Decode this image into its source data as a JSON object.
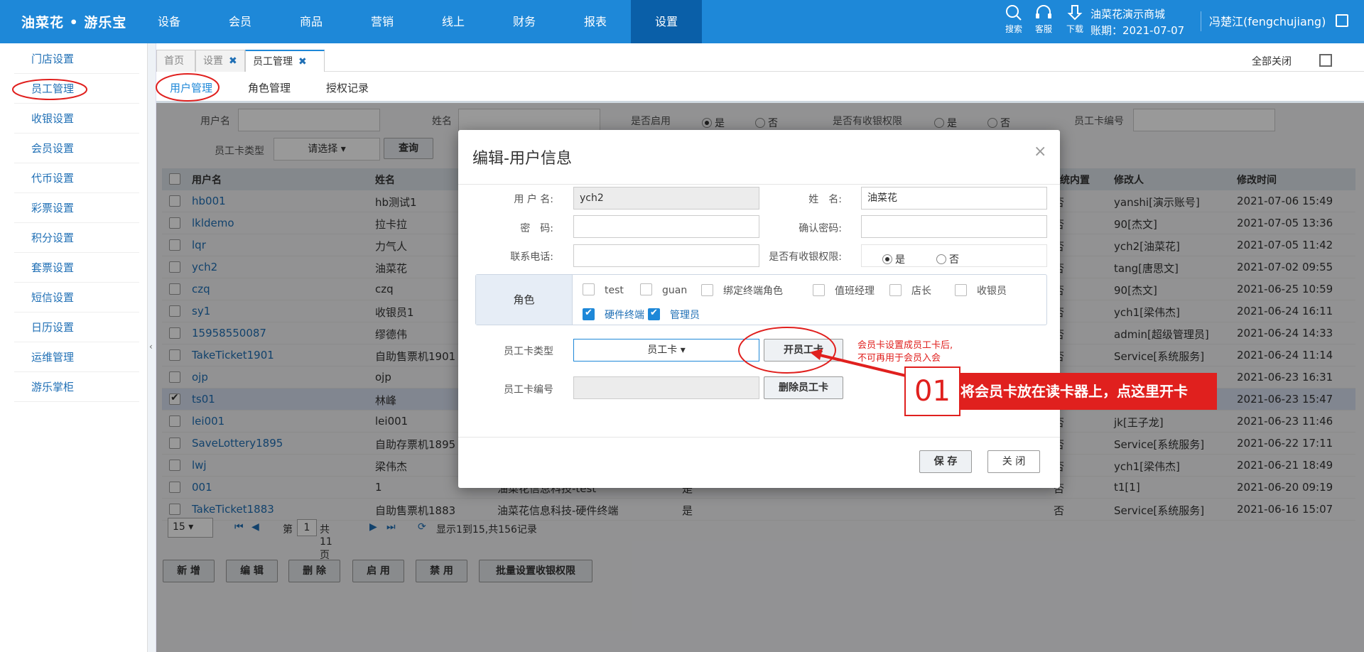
{
  "app": {
    "logo": "油菜花 • 游乐宝"
  },
  "nav": [
    "设备",
    "会员",
    "商品",
    "营销",
    "线上",
    "财务",
    "报表",
    "设置"
  ],
  "topright": {
    "icons": [
      {
        "label": "搜索",
        "icon": "search-icon"
      },
      {
        "label": "客服",
        "icon": "headset-icon"
      },
      {
        "label": "下载",
        "icon": "download-icon"
      }
    ],
    "store": "油菜花演示商城",
    "account_period": "账期：2021-07-07",
    "user": "冯楚江(fengchujiang)"
  },
  "sidebar": [
    "门店设置",
    "员工管理",
    "收银设置",
    "会员设置",
    "代币设置",
    "彩票设置",
    "积分设置",
    "套票设置",
    "短信设置",
    "日历设置",
    "运维管理",
    "游乐掌柜"
  ],
  "pagetabs": [
    {
      "label": "首页"
    },
    {
      "label": "设置"
    },
    {
      "label": "员工管理"
    }
  ],
  "close_all": "全部关闭",
  "subtabs": [
    "用户管理",
    "角色管理",
    "授权记录"
  ],
  "filters": {
    "username": "用户名",
    "name": "姓名",
    "enabled": "是否启用",
    "yes": "是",
    "no": "否",
    "cashier": "是否有收银权限",
    "card_no": "员工卡编号",
    "card_type": "员工卡类型",
    "card_type_value": "请选择",
    "query": "查询"
  },
  "grid": {
    "headers": {
      "username": "用户名",
      "name": "姓名",
      "builtin": "系统内置",
      "modifier": "修改人",
      "time": "修改时间"
    },
    "rows": [
      {
        "username": "hb001",
        "name": "hb测试1",
        "builtin": "否",
        "modifier": "yanshi[演示账号]",
        "time": "2021-07-06 15:49"
      },
      {
        "username": "lkldemo",
        "name": "拉卡拉",
        "builtin": "否",
        "modifier": "90[杰文]",
        "time": "2021-07-05 13:36"
      },
      {
        "username": "lqr",
        "name": "力气人",
        "builtin": "否",
        "modifier": "ych2[油菜花]",
        "time": "2021-07-05 11:42"
      },
      {
        "username": "ych2",
        "name": "油菜花",
        "builtin": "否",
        "modifier": "tang[唐思文]",
        "time": "2021-07-02 09:55"
      },
      {
        "username": "czq",
        "name": "czq",
        "builtin": "否",
        "modifier": "90[杰文]",
        "time": "2021-06-25 10:59"
      },
      {
        "username": "sy1",
        "name": "收银员1",
        "builtin": "否",
        "modifier": "ych1[梁伟杰]",
        "time": "2021-06-24 16:11"
      },
      {
        "username": "15958550087",
        "name": "缪德伟",
        "builtin": "否",
        "modifier": "admin[超级管理员]",
        "time": "2021-06-24 14:33"
      },
      {
        "username": "TakeTicket1901",
        "name": "自助售票机1901",
        "builtin": "否",
        "modifier": "Service[系统服务]",
        "time": "2021-06-24 11:14"
      },
      {
        "username": "ojp",
        "name": "ojp",
        "builtin": "否",
        "modifier": "",
        "time": "2021-06-23 16:31"
      },
      {
        "username": "ts01",
        "name": "林峰",
        "builtin": "否",
        "modifier": "",
        "time": "2021-06-23 15:47"
      },
      {
        "username": "lei001",
        "name": "lei001",
        "builtin": "否",
        "modifier": "jk[王子龙]",
        "time": "2021-06-23 11:46"
      },
      {
        "username": "SaveLottery1895",
        "name": "自助存票机1895",
        "builtin": "否",
        "modifier": "Service[系统服务]",
        "time": "2021-06-22 17:11"
      },
      {
        "username": "lwj",
        "name": "梁伟杰",
        "builtin": "否",
        "modifier": "ych1[梁伟杰]",
        "time": "2021-06-21 18:49"
      },
      {
        "username": "001",
        "name": "1",
        "dept": "油菜花信息科技-test",
        "enabled": "是",
        "builtin": "否",
        "modifier": "t1[1]",
        "time": "2021-06-20 09:19"
      },
      {
        "username": "TakeTicket1883",
        "name": "自助售票机1883",
        "dept": "油菜花信息科技-硬件终端",
        "enabled": "是",
        "builtin": "否",
        "modifier": "Service[系统服务]",
        "time": "2021-06-16 15:07"
      }
    ]
  },
  "pager": {
    "page_size": "15",
    "page_prefix": "第",
    "page": "1",
    "page_suffix": "共11页",
    "summary": "显示1到15,共156记录"
  },
  "actions": [
    "新 增",
    "编 辑",
    "删 除",
    "启 用",
    "禁 用",
    "批量设置收银权限"
  ],
  "modal": {
    "title": "编辑-用户信息",
    "username_label": "用 户 名:",
    "username": "ych2",
    "name_label": "姓　名:",
    "name": "油菜花",
    "password_label": "密　码:",
    "confirm_label": "确认密码:",
    "phone_label": "联系电话:",
    "cashier_label": "是否有收银权限:",
    "yes": "是",
    "no": "否",
    "role_label": "角色",
    "roles": [
      {
        "label": "test",
        "checked": false
      },
      {
        "label": "guan",
        "checked": false
      },
      {
        "label": "绑定终端角色",
        "checked": false
      },
      {
        "label": "值班经理",
        "checked": false
      },
      {
        "label": "店长",
        "checked": false
      },
      {
        "label": "收银员",
        "checked": false
      },
      {
        "label": "硬件终端",
        "checked": true
      },
      {
        "label": "管理员",
        "checked": true
      }
    ],
    "card_type_label": "员工卡类型",
    "card_type": "员工卡",
    "open_card": "开员工卡",
    "card_no_label": "员工卡编号",
    "delete_card": "删除员工卡",
    "save": "保 存",
    "close": "关 闭"
  },
  "annotation": {
    "note_line1": "会员卡设置成员工卡后,",
    "note_line2": "不可再用于会员入会",
    "step": "01",
    "text": "将会员卡放在读卡器上，点这里开卡",
    "color": "#e0201e"
  }
}
